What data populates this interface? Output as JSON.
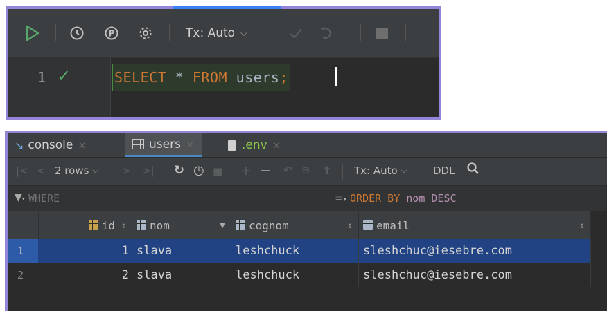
{
  "editor": {
    "toolbar": {
      "execute_icon": "play-icon",
      "history_icon": "clock-icon",
      "pin_icon": "pin-p-icon",
      "settings_icon": "gear-icon",
      "tx_label": "Tx: Auto",
      "commit_icon": "check-icon",
      "rollback_icon": "undo-icon",
      "stop_icon": "stop-icon"
    },
    "line_number": "1",
    "line_status": "✓",
    "sql": {
      "select": "SELECT",
      "star": "*",
      "from": "FROM",
      "table": "users",
      "semicolon": ";"
    }
  },
  "results": {
    "tabs": [
      {
        "label": "console",
        "icon": "console-icon"
      },
      {
        "label": "users",
        "icon": "table-icon"
      },
      {
        "label": ".env",
        "icon": "file-icon"
      }
    ],
    "toolbar": {
      "rows_label": "2 rows",
      "tx_label": "Tx: Auto",
      "ddl_label": "DDL"
    },
    "filter": {
      "where_label": "WHERE",
      "order_by_keyword": "ORDER BY",
      "order_by_value": "nom DESC"
    },
    "columns": [
      "id",
      "nom",
      "cognom",
      "email"
    ],
    "rows": [
      {
        "rownum": "1",
        "id": "1",
        "nom": "slava",
        "cognom": "leshchuck",
        "email": "sleshchuc@iesebre.com"
      },
      {
        "rownum": "2",
        "id": "2",
        "nom": "slava",
        "cognom": "leshchuck",
        "email": "sleshchuc@iesebre.com"
      }
    ]
  },
  "colors": {
    "accent_border": "#9585d8",
    "selection": "#214283",
    "keyword": "#cc7832",
    "success": "#59a869"
  }
}
